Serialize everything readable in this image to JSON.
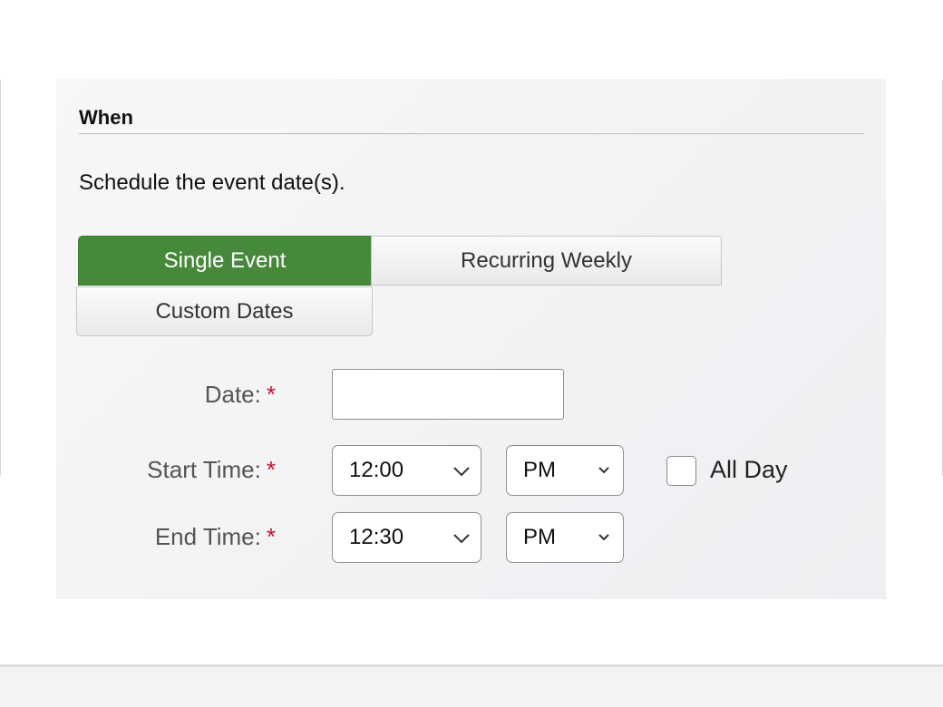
{
  "section": {
    "title": "When",
    "intro": "Schedule the event date(s)."
  },
  "event_type": {
    "options": [
      "Single Event",
      "Recurring Weekly",
      "Custom Dates"
    ],
    "selected": "Single Event"
  },
  "fields": {
    "date_label": "Date:",
    "date_value": "",
    "start_label": "Start Time:",
    "end_label": "End Time:",
    "required_marker": "*"
  },
  "start": {
    "time": "12:00",
    "ampm": "PM"
  },
  "end": {
    "time": "12:30",
    "ampm": "PM"
  },
  "all_day": {
    "label": "All Day",
    "checked": false
  },
  "colors": {
    "active_tab": "#46893b",
    "required": "#c8102e"
  }
}
